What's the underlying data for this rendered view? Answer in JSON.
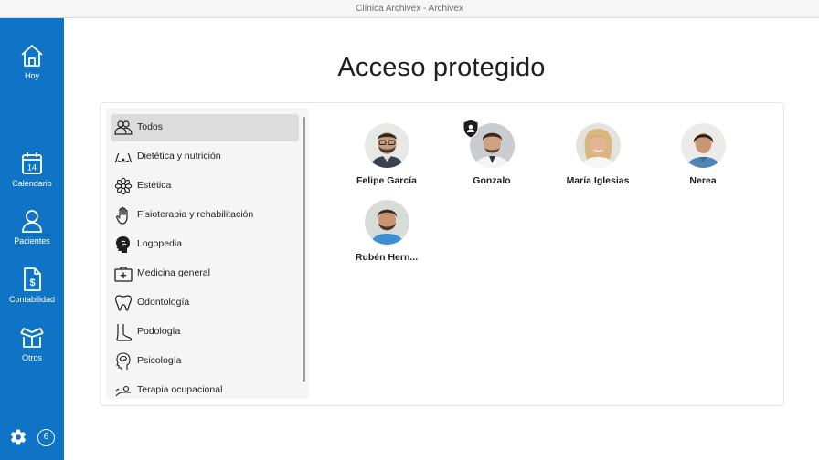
{
  "window": {
    "title": "Clínica Archivex - Archivex"
  },
  "sidebar": {
    "items": [
      {
        "label": "Hoy",
        "icon": "home-icon"
      },
      {
        "label": "Calendario",
        "icon": "calendar-icon",
        "day": "14"
      },
      {
        "label": "Pacientes",
        "icon": "user-icon"
      },
      {
        "label": "Contabilidad",
        "icon": "invoice-icon"
      },
      {
        "label": "Otros",
        "icon": "box-icon"
      }
    ],
    "settings_icon": "gear-icon",
    "badge_count": "6",
    "background": "#0f74c6"
  },
  "main": {
    "title": "Acceso protegido",
    "categories": [
      {
        "label": "Todos",
        "icon": "group-icon",
        "selected": true
      },
      {
        "label": "Dietética y nutrición",
        "icon": "nutrition-icon"
      },
      {
        "label": "Estética",
        "icon": "flower-icon"
      },
      {
        "label": "Fisioterapia y rehabilitación",
        "icon": "hand-icon"
      },
      {
        "label": "Logopedia",
        "icon": "speech-head-icon"
      },
      {
        "label": "Medicina general",
        "icon": "medical-kit-icon"
      },
      {
        "label": "Odontología",
        "icon": "tooth-icon"
      },
      {
        "label": "Podología",
        "icon": "foot-icon"
      },
      {
        "label": "Psicología",
        "icon": "brain-head-icon"
      },
      {
        "label": "Terapia ocupacional",
        "icon": "therapy-icon"
      }
    ],
    "professionals": [
      {
        "name": "Felipe García",
        "protected": false
      },
      {
        "name": "Gonzalo",
        "protected": true
      },
      {
        "name": "María Iglesias",
        "protected": false
      },
      {
        "name": "Nerea",
        "protected": false
      },
      {
        "name": "Rubén Hern...",
        "protected": false
      }
    ]
  }
}
